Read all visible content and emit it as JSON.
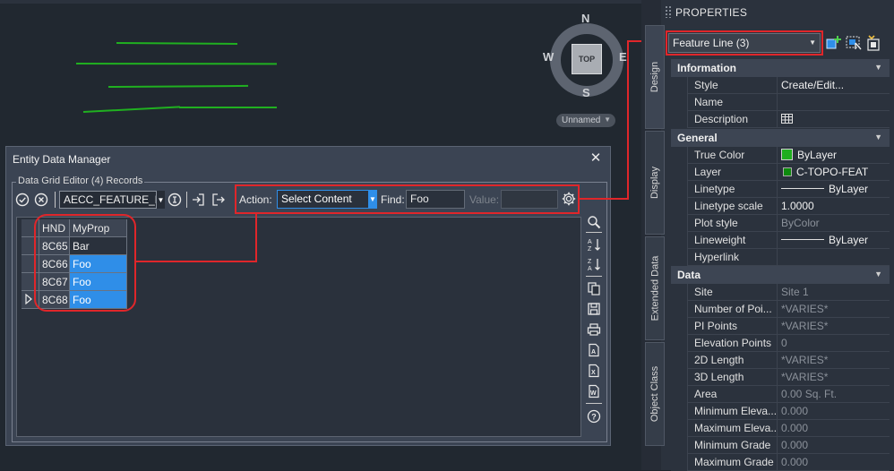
{
  "viewcube": {
    "north": "N",
    "south": "S",
    "east": "E",
    "west": "W",
    "face": "TOP",
    "view_menu": "Unnamed"
  },
  "dialog": {
    "title": "Entity Data Manager",
    "group_label": "Data Grid Editor (4) Records",
    "entity_type": "AECC_FEATURE_LINE",
    "action_label": "Action:",
    "action_value": "Select Content",
    "find_label": "Find:",
    "find_value": "Foo",
    "value_label": "Value:",
    "value_value": "",
    "columns": [
      "HND",
      "MyProp"
    ],
    "rows": [
      {
        "hnd": "8C65",
        "prop": "Bar",
        "selected": false,
        "current": false
      },
      {
        "hnd": "8C66",
        "prop": "Foo",
        "selected": true,
        "current": false
      },
      {
        "hnd": "8C67",
        "prop": "Foo",
        "selected": true,
        "current": false
      },
      {
        "hnd": "8C68",
        "prop": "Foo",
        "selected": true,
        "current": true
      }
    ],
    "icons": {
      "toolbar": [
        "confirm-icon",
        "cancel-icon",
        "info-icon",
        "import-icon",
        "export-icon",
        "settings-icon"
      ],
      "side": [
        "zoom-icon",
        "sort-ascending-icon",
        "sort-descending-icon",
        "copy-icon",
        "save-icon",
        "print-icon",
        "export-access-icon",
        "export-excel-icon",
        "export-word-icon",
        "help-icon"
      ]
    }
  },
  "properties": {
    "title": "PROPERTIES",
    "selection": "Feature Line (3)",
    "tabs": [
      "Design",
      "Display",
      "Extended Data",
      "Object Class"
    ],
    "sections": {
      "information": {
        "title": "Information",
        "rows": [
          {
            "key": "Style",
            "value": "Create/Edit..."
          },
          {
            "key": "Name",
            "value": ""
          },
          {
            "key": "Description",
            "value": ""
          }
        ]
      },
      "general": {
        "title": "General",
        "rows": [
          {
            "key": "True Color",
            "value": "ByLayer",
            "swatch": "#1fae1f"
          },
          {
            "key": "Layer",
            "value": "C-TOPO-FEAT",
            "swatch": "#0e8a0e"
          },
          {
            "key": "Linetype",
            "value": "ByLayer"
          },
          {
            "key": "Linetype scale",
            "value": "1.0000"
          },
          {
            "key": "Plot style",
            "value": "ByColor"
          },
          {
            "key": "Lineweight",
            "value": "ByLayer"
          },
          {
            "key": "Hyperlink",
            "value": ""
          }
        ]
      },
      "data": {
        "title": "Data",
        "rows": [
          {
            "key": "Site",
            "value": "Site 1"
          },
          {
            "key": "Number of Poi...",
            "value": "*VARIES*"
          },
          {
            "key": "PI Points",
            "value": "*VARIES*"
          },
          {
            "key": "Elevation Points",
            "value": "0"
          },
          {
            "key": "2D Length",
            "value": "*VARIES*"
          },
          {
            "key": "3D Length",
            "value": "*VARIES*"
          },
          {
            "key": "Area",
            "value": "0.00 Sq. Ft."
          },
          {
            "key": "Minimum Eleva...",
            "value": "0.000"
          },
          {
            "key": "Maximum Eleva...",
            "value": "0.000"
          },
          {
            "key": "Minimum Grade",
            "value": "0.000"
          },
          {
            "key": "Maximum Grade",
            "value": "0.000"
          }
        ]
      }
    }
  },
  "colors": {
    "highlight": "#e0262a",
    "selection": "#2f8ee8",
    "feature_line": "#20b020"
  }
}
